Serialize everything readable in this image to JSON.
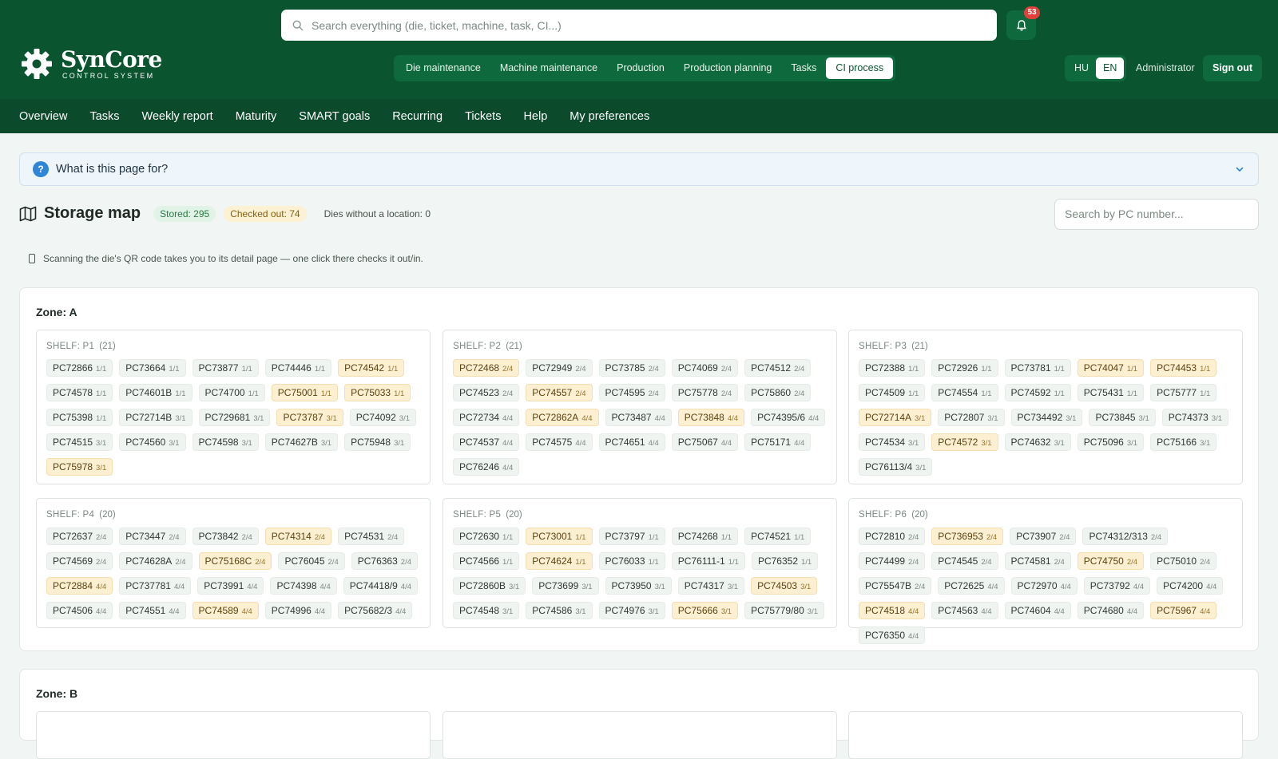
{
  "app": {
    "logo_name": "SynCore",
    "logo_sub": "CONTROL SYSTEM",
    "search_placeholder": "Search everything (die, ticket, machine, task, CI...)",
    "notification_count": "53",
    "modules": [
      "Die maintenance",
      "Machine maintenance",
      "Production",
      "Production planning",
      "Tasks",
      "CI process"
    ],
    "active_module": "CI process",
    "languages": [
      "HU",
      "EN"
    ],
    "active_language": "EN",
    "user": "Administrator",
    "sign_out": "Sign out",
    "subnav": [
      "Overview",
      "Tasks",
      "Weekly report",
      "Maturity",
      "SMART goals",
      "Recurring",
      "Tickets",
      "Help",
      "My preferences"
    ]
  },
  "help": {
    "question_mark": "?",
    "label": "What is this page for?"
  },
  "page": {
    "title": "Storage map",
    "stored": "Stored: 295",
    "checked_out": "Checked out: 74",
    "no_location": "Dies without a location: 0",
    "pc_search_placeholder": "Search by PC number...",
    "hint": "Scanning the die's QR code takes you to its detail page — one click there checks it out/in."
  },
  "colors": {
    "header": "#0a5530",
    "subnav": "#0b4a2b",
    "stored_chip": "#f0f4f1",
    "checked_out_chip": "#fcefd2"
  },
  "zones": [
    {
      "label": "Zone: A",
      "shelves": [
        {
          "name": "SHELF: P1",
          "count": "(21)",
          "dies": [
            {
              "pc": "PC72866",
              "f": "1/1",
              "out": false
            },
            {
              "pc": "PC73664",
              "f": "1/1",
              "out": false
            },
            {
              "pc": "PC73877",
              "f": "1/1",
              "out": false
            },
            {
              "pc": "PC74446",
              "f": "1/1",
              "out": false
            },
            {
              "pc": "PC74542",
              "f": "1/1",
              "out": true
            },
            {
              "pc": "PC74578",
              "f": "1/1",
              "out": false
            },
            {
              "pc": "PC74601B",
              "f": "1/1",
              "out": false
            },
            {
              "pc": "PC74700",
              "f": "1/1",
              "out": false
            },
            {
              "pc": "PC75001",
              "f": "1/1",
              "out": true
            },
            {
              "pc": "PC75033",
              "f": "1/1",
              "out": true
            },
            {
              "pc": "PC75398",
              "f": "1/1",
              "out": false
            },
            {
              "pc": "PC72714B",
              "f": "3/1",
              "out": false
            },
            {
              "pc": "PC729681",
              "f": "3/1",
              "out": false
            },
            {
              "pc": "PC73787",
              "f": "3/1",
              "out": true
            },
            {
              "pc": "PC74092",
              "f": "3/1",
              "out": false
            },
            {
              "pc": "PC74515",
              "f": "3/1",
              "out": false
            },
            {
              "pc": "PC74560",
              "f": "3/1",
              "out": false
            },
            {
              "pc": "PC74598",
              "f": "3/1",
              "out": false
            },
            {
              "pc": "PC74627B",
              "f": "3/1",
              "out": false
            },
            {
              "pc": "PC75948",
              "f": "3/1",
              "out": false
            },
            {
              "pc": "PC75978",
              "f": "3/1",
              "out": true
            }
          ]
        },
        {
          "name": "SHELF: P2",
          "count": "(21)",
          "dies": [
            {
              "pc": "PC72468",
              "f": "2/4",
              "out": true
            },
            {
              "pc": "PC72949",
              "f": "2/4",
              "out": false
            },
            {
              "pc": "PC73785",
              "f": "2/4",
              "out": false
            },
            {
              "pc": "PC74069",
              "f": "2/4",
              "out": false
            },
            {
              "pc": "PC74512",
              "f": "2/4",
              "out": false
            },
            {
              "pc": "PC74523",
              "f": "2/4",
              "out": false
            },
            {
              "pc": "PC74557",
              "f": "2/4",
              "out": true
            },
            {
              "pc": "PC74595",
              "f": "2/4",
              "out": false
            },
            {
              "pc": "PC75778",
              "f": "2/4",
              "out": false
            },
            {
              "pc": "PC75860",
              "f": "2/4",
              "out": false
            },
            {
              "pc": "PC72734",
              "f": "4/4",
              "out": false
            },
            {
              "pc": "PC72862A",
              "f": "4/4",
              "out": true
            },
            {
              "pc": "PC73487",
              "f": "4/4",
              "out": false
            },
            {
              "pc": "PC73848",
              "f": "4/4",
              "out": true
            },
            {
              "pc": "PC74395/6",
              "f": "4/4",
              "out": false
            },
            {
              "pc": "PC74537",
              "f": "4/4",
              "out": false
            },
            {
              "pc": "PC74575",
              "f": "4/4",
              "out": false
            },
            {
              "pc": "PC74651",
              "f": "4/4",
              "out": false
            },
            {
              "pc": "PC75067",
              "f": "4/4",
              "out": false
            },
            {
              "pc": "PC75171",
              "f": "4/4",
              "out": false
            },
            {
              "pc": "PC76246",
              "f": "4/4",
              "out": false
            }
          ]
        },
        {
          "name": "SHELF: P3",
          "count": "(21)",
          "dies": [
            {
              "pc": "PC72388",
              "f": "1/1",
              "out": false
            },
            {
              "pc": "PC72926",
              "f": "1/1",
              "out": false
            },
            {
              "pc": "PC73781",
              "f": "1/1",
              "out": false
            },
            {
              "pc": "PC74047",
              "f": "1/1",
              "out": true
            },
            {
              "pc": "PC74453",
              "f": "1/1",
              "out": true
            },
            {
              "pc": "PC74509",
              "f": "1/1",
              "out": false
            },
            {
              "pc": "PC74554",
              "f": "1/1",
              "out": false
            },
            {
              "pc": "PC74592",
              "f": "1/1",
              "out": false
            },
            {
              "pc": "PC75431",
              "f": "1/1",
              "out": false
            },
            {
              "pc": "PC75777",
              "f": "1/1",
              "out": false
            },
            {
              "pc": "PC72714A",
              "f": "3/1",
              "out": true
            },
            {
              "pc": "PC72807",
              "f": "3/1",
              "out": false
            },
            {
              "pc": "PC734492",
              "f": "3/1",
              "out": false
            },
            {
              "pc": "PC73845",
              "f": "3/1",
              "out": false
            },
            {
              "pc": "PC74373",
              "f": "3/1",
              "out": false
            },
            {
              "pc": "PC74534",
              "f": "3/1",
              "out": false
            },
            {
              "pc": "PC74572",
              "f": "3/1",
              "out": true
            },
            {
              "pc": "PC74632",
              "f": "3/1",
              "out": false
            },
            {
              "pc": "PC75096",
              "f": "3/1",
              "out": false
            },
            {
              "pc": "PC75166",
              "f": "3/1",
              "out": false
            },
            {
              "pc": "PC76113/4",
              "f": "3/1",
              "out": false
            }
          ]
        },
        {
          "name": "SHELF: P4",
          "count": "(20)",
          "dies": [
            {
              "pc": "PC72637",
              "f": "2/4",
              "out": false
            },
            {
              "pc": "PC73447",
              "f": "2/4",
              "out": false
            },
            {
              "pc": "PC73842",
              "f": "2/4",
              "out": false
            },
            {
              "pc": "PC74314",
              "f": "2/4",
              "out": true
            },
            {
              "pc": "PC74531",
              "f": "2/4",
              "out": false
            },
            {
              "pc": "PC74569",
              "f": "2/4",
              "out": false
            },
            {
              "pc": "PC74628A",
              "f": "2/4",
              "out": false
            },
            {
              "pc": "PC75168C",
              "f": "2/4",
              "out": true
            },
            {
              "pc": "PC76045",
              "f": "2/4",
              "out": false
            },
            {
              "pc": "PC76363",
              "f": "2/4",
              "out": false
            },
            {
              "pc": "PC72884",
              "f": "4/4",
              "out": true
            },
            {
              "pc": "PC737781",
              "f": "4/4",
              "out": false
            },
            {
              "pc": "PC73991",
              "f": "4/4",
              "out": false
            },
            {
              "pc": "PC74398",
              "f": "4/4",
              "out": false
            },
            {
              "pc": "PC74418/9",
              "f": "4/4",
              "out": false
            },
            {
              "pc": "PC74506",
              "f": "4/4",
              "out": false
            },
            {
              "pc": "PC74551",
              "f": "4/4",
              "out": false
            },
            {
              "pc": "PC74589",
              "f": "4/4",
              "out": true
            },
            {
              "pc": "PC74996",
              "f": "4/4",
              "out": false
            },
            {
              "pc": "PC75682/3",
              "f": "4/4",
              "out": false
            }
          ]
        },
        {
          "name": "SHELF: P5",
          "count": "(20)",
          "dies": [
            {
              "pc": "PC72630",
              "f": "1/1",
              "out": false
            },
            {
              "pc": "PC73001",
              "f": "1/1",
              "out": true
            },
            {
              "pc": "PC73797",
              "f": "1/1",
              "out": false
            },
            {
              "pc": "PC74268",
              "f": "1/1",
              "out": false
            },
            {
              "pc": "PC74521",
              "f": "1/1",
              "out": false
            },
            {
              "pc": "PC74566",
              "f": "1/1",
              "out": false
            },
            {
              "pc": "PC74624",
              "f": "1/1",
              "out": true
            },
            {
              "pc": "PC76033",
              "f": "1/1",
              "out": false
            },
            {
              "pc": "PC76111-1",
              "f": "1/1",
              "out": false
            },
            {
              "pc": "PC76352",
              "f": "1/1",
              "out": false
            },
            {
              "pc": "PC72860B",
              "f": "3/1",
              "out": false
            },
            {
              "pc": "PC73699",
              "f": "3/1",
              "out": false
            },
            {
              "pc": "PC73950",
              "f": "3/1",
              "out": false
            },
            {
              "pc": "PC74317",
              "f": "3/1",
              "out": false
            },
            {
              "pc": "PC74503",
              "f": "3/1",
              "out": true
            },
            {
              "pc": "PC74548",
              "f": "3/1",
              "out": false
            },
            {
              "pc": "PC74586",
              "f": "3/1",
              "out": false
            },
            {
              "pc": "PC74976",
              "f": "3/1",
              "out": false
            },
            {
              "pc": "PC75666",
              "f": "3/1",
              "out": true
            },
            {
              "pc": "PC75779/80",
              "f": "3/1",
              "out": false
            }
          ]
        },
        {
          "name": "SHELF: P6",
          "count": "(20)",
          "dies": [
            {
              "pc": "PC72810",
              "f": "2/4",
              "out": false
            },
            {
              "pc": "PC736953",
              "f": "2/4",
              "out": true
            },
            {
              "pc": "PC73907",
              "f": "2/4",
              "out": false
            },
            {
              "pc": "PC74312/313",
              "f": "2/4",
              "out": false
            },
            {
              "pc": "PC74499",
              "f": "2/4",
              "out": false
            },
            {
              "pc": "PC74545",
              "f": "2/4",
              "out": false
            },
            {
              "pc": "PC74581",
              "f": "2/4",
              "out": false
            },
            {
              "pc": "PC74750",
              "f": "2/4",
              "out": true
            },
            {
              "pc": "PC75010",
              "f": "2/4",
              "out": false
            },
            {
              "pc": "PC75547B",
              "f": "2/4",
              "out": false
            },
            {
              "pc": "PC72625",
              "f": "4/4",
              "out": false
            },
            {
              "pc": "PC72970",
              "f": "4/4",
              "out": false
            },
            {
              "pc": "PC73792",
              "f": "4/4",
              "out": false
            },
            {
              "pc": "PC74200",
              "f": "4/4",
              "out": false
            },
            {
              "pc": "PC74518",
              "f": "4/4",
              "out": true
            },
            {
              "pc": "PC74563",
              "f": "4/4",
              "out": false
            },
            {
              "pc": "PC74604",
              "f": "4/4",
              "out": false
            },
            {
              "pc": "PC74680",
              "f": "4/4",
              "out": false
            },
            {
              "pc": "PC75967",
              "f": "4/4",
              "out": true
            },
            {
              "pc": "PC76350",
              "f": "4/4",
              "out": false
            }
          ]
        }
      ]
    },
    {
      "label": "Zone: B",
      "shelves": []
    }
  ]
}
